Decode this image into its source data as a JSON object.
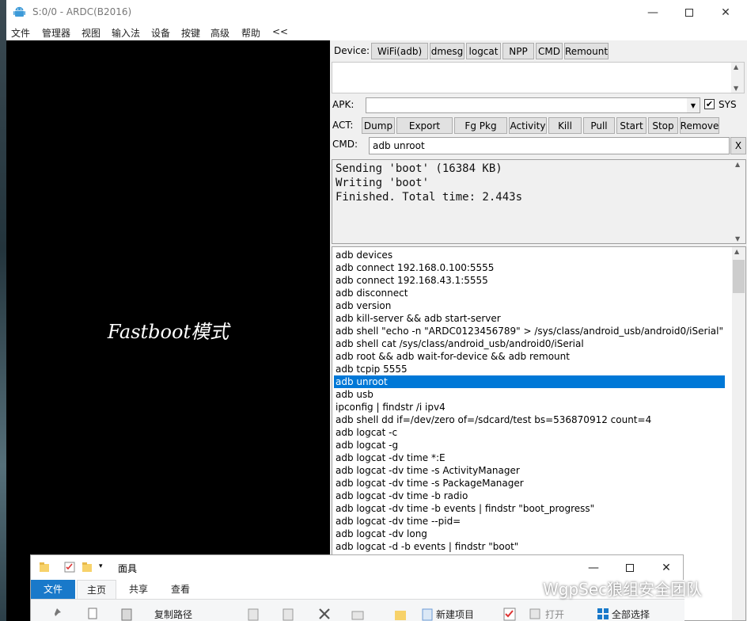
{
  "window": {
    "title": "S:0/0 - ARDC(B2016)",
    "menu": [
      "文件",
      "管理器",
      "视图",
      "输入法",
      "设备",
      "按键",
      "高级",
      "帮助",
      "<<"
    ]
  },
  "screen": {
    "text": "Fastboot模式"
  },
  "panel": {
    "device_label": "Device:",
    "device_buttons": [
      "WiFi(adb)",
      "dmesg",
      "logcat",
      "NPP",
      "CMD",
      "Remount"
    ],
    "apk_label": "APK:",
    "apk_value": "",
    "sys_label": "SYS",
    "sys_checked": "✔",
    "act_label": "ACT:",
    "act_buttons": [
      "Dump",
      "Export",
      "Fg Pkg",
      "Activity",
      "Kill",
      "Pull",
      "Start",
      "Stop",
      "Remove"
    ],
    "cmd_label": "CMD:",
    "cmd_value": "adb unroot",
    "cmd_clear": "X",
    "console_lines": "Sending 'boot' (16384 KB)\nWriting 'boot'\nFinished. Total time: 2.443s",
    "selected_command": "adb unroot",
    "commands": [
      "adb devices",
      "adb connect 192.168.0.100:5555",
      "adb connect 192.168.43.1:5555",
      "adb disconnect",
      "adb version",
      "adb kill-server && adb start-server",
      "adb shell \"echo -n \"ARDC0123456789\" > /sys/class/android_usb/android0/iSerial\"",
      "adb shell cat /sys/class/android_usb/android0/iSerial",
      "adb root && adb wait-for-device && adb remount",
      "adb tcpip 5555",
      "adb unroot",
      "adb usb",
      "ipconfig | findstr /i ipv4",
      "adb shell dd if=/dev/zero of=/sdcard/test bs=536870912 count=4",
      "adb logcat -c",
      "adb logcat -g",
      "adb logcat -dv time *:E",
      "adb logcat -dv time -s ActivityManager",
      "adb logcat -dv time -s PackageManager",
      "adb logcat -dv time -b radio",
      "adb logcat -dv time -b events | findstr \"boot_progress\"",
      "adb logcat -dv time --pid=",
      "adb logcat -dv long",
      "adb logcat -d -b events | findstr \"boot\""
    ]
  },
  "explorer": {
    "title": "面具",
    "tabs": [
      "文件",
      "主页",
      "共享",
      "查看"
    ],
    "ribbon": {
      "copy_path": "复制路径",
      "new_item": "新建项目",
      "open": "打开",
      "select_all": "全部选择"
    }
  },
  "watermark": {
    "text": "WgpSec狼组安全团队"
  },
  "colors": {
    "selection": "#0078d7",
    "explorer_file_tab": "#1979ca",
    "screen_bg": "#000000"
  }
}
